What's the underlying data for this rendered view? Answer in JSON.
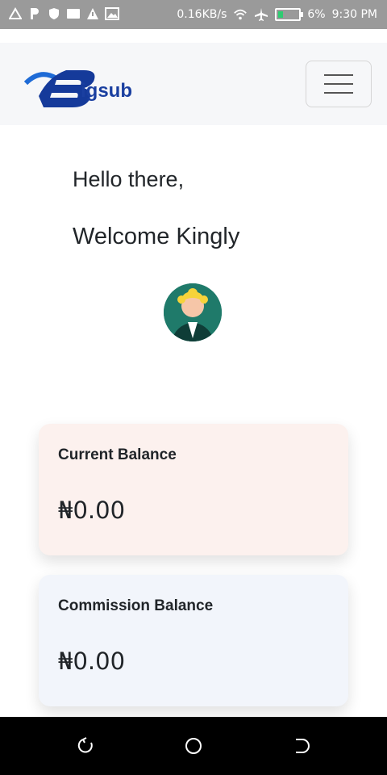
{
  "status_bar": {
    "speed": "0.16KB/s",
    "battery": "6%",
    "time": "9:30 PM",
    "battery_level": 0.06,
    "left_icons": [
      "warning-triangle-icon",
      "parking-icon",
      "shield-icon",
      "card-icon",
      "alert-icon",
      "gallery-icon"
    ],
    "right_icons": [
      "wifi-icon",
      "airplane-icon",
      "battery-icon"
    ]
  },
  "navbar": {
    "logo_text": "igsub",
    "menu_icon": "hamburger-icon"
  },
  "greeting": {
    "line1": "Hello there,",
    "line2": "Welcome Kingly"
  },
  "cards": [
    {
      "title": "Current Balance",
      "amount": "₦0.00",
      "color": "#fcf1ee"
    },
    {
      "title": "Commission Balance",
      "amount": "₦0.00",
      "color": "#f2f5fb"
    }
  ],
  "nav_bar": {
    "buttons": [
      "back-icon",
      "home-icon",
      "recent-apps-icon"
    ]
  }
}
